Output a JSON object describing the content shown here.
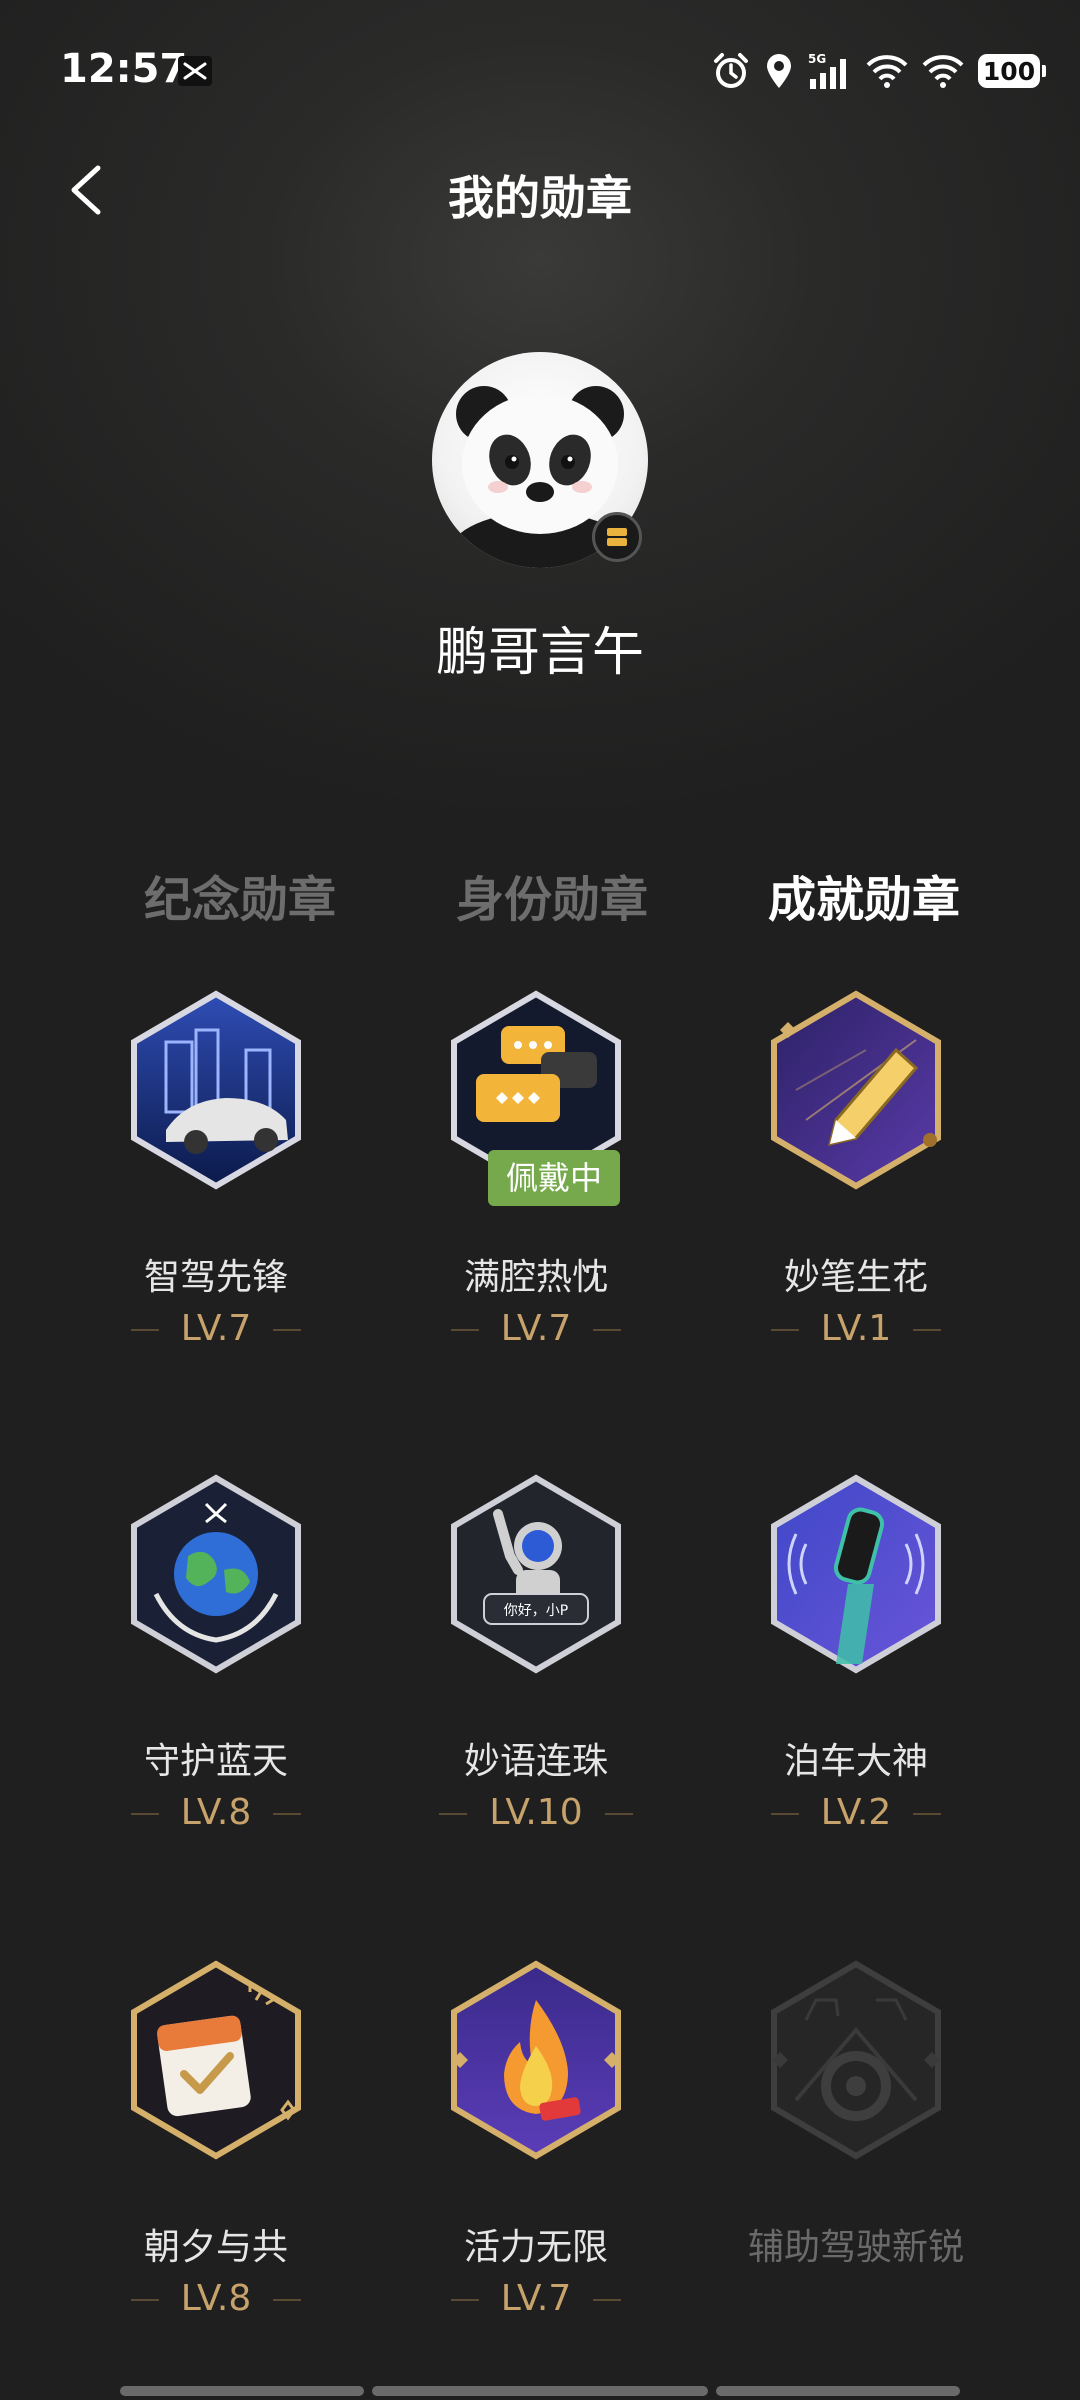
{
  "status_bar": {
    "time": "12:57",
    "network": "5G",
    "battery": "100",
    "icons": [
      "scissors-icon",
      "alarm-icon",
      "location-icon",
      "signal-icon",
      "wifi-icon",
      "wifi-icon",
      "battery-icon"
    ]
  },
  "header": {
    "title": "我的勋章",
    "back_icon": "back-arrow-icon"
  },
  "profile": {
    "name": "鹏哥言午",
    "avatar": "panda-avatar"
  },
  "tabs": [
    {
      "label": "纪念勋章",
      "active": false
    },
    {
      "label": "身份勋章",
      "active": false
    },
    {
      "label": "成就勋章",
      "active": true
    }
  ],
  "badges": [
    {
      "name": "智驾先锋",
      "level": "LV.7",
      "icon": "city-car-icon",
      "wearing": false,
      "locked": false
    },
    {
      "name": "满腔热忱",
      "level": "LV.7",
      "icon": "chat-bubbles-icon",
      "wearing": true,
      "wearing_label": "佩戴中",
      "locked": false
    },
    {
      "name": "妙笔生花",
      "level": "LV.1",
      "icon": "pencil-icon",
      "wearing": false,
      "locked": false
    },
    {
      "name": "守护蓝天",
      "level": "LV.8",
      "icon": "earth-hands-icon",
      "wearing": false,
      "locked": false
    },
    {
      "name": "妙语连珠",
      "level": "LV.10",
      "icon": "astronaut-icon",
      "wearing": false,
      "locked": false,
      "icon_text": "你好，小P"
    },
    {
      "name": "泊车大神",
      "level": "LV.2",
      "icon": "parking-car-icon",
      "wearing": false,
      "locked": false
    },
    {
      "name": "朝夕与共",
      "level": "LV.8",
      "icon": "calendar-check-icon",
      "wearing": false,
      "locked": false
    },
    {
      "name": "活力无限",
      "level": "LV.7",
      "icon": "flame-icon",
      "wearing": false,
      "locked": false
    },
    {
      "name": "辅助驾驶新锐",
      "level": "",
      "icon": "steering-wheel-icon",
      "wearing": false,
      "locked": true
    }
  ],
  "colors": {
    "background": "#1f1f1f",
    "level_gold": "#c7a36b",
    "wearing_green": "#76a94c",
    "inactive_tab": "#6d6d6d"
  }
}
